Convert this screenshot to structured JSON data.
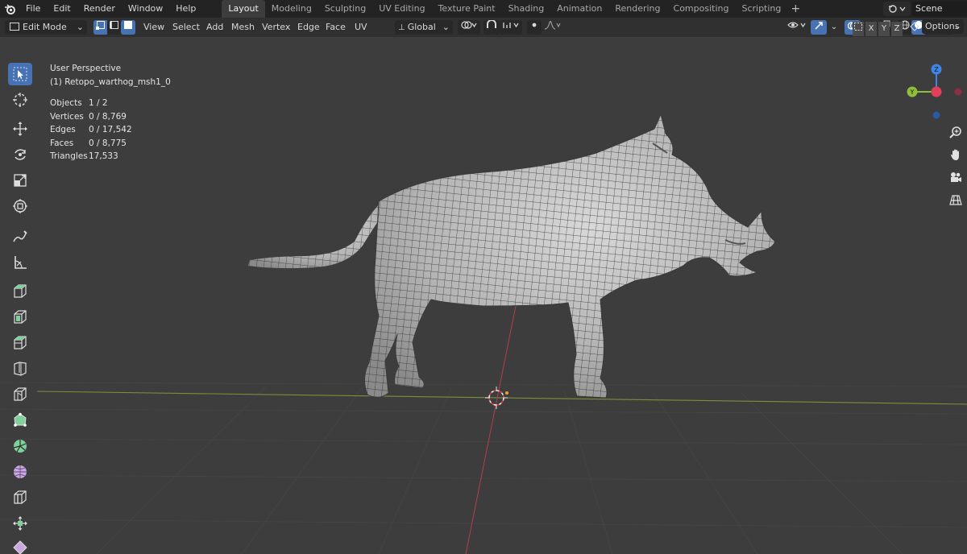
{
  "app": {
    "menus": [
      "File",
      "Edit",
      "Render",
      "Window",
      "Help"
    ]
  },
  "workspaces": {
    "tabs": [
      "Layout",
      "Modeling",
      "Sculpting",
      "UV Editing",
      "Texture Paint",
      "Shading",
      "Animation",
      "Rendering",
      "Compositing",
      "Scripting"
    ],
    "active": "Layout",
    "add_symbol": "+"
  },
  "scene": {
    "label": "Scene"
  },
  "header": {
    "mode_label": "Edit Mode",
    "menus": [
      "View",
      "Select",
      "Add",
      "Mesh",
      "Vertex",
      "Edge",
      "Face",
      "UV"
    ],
    "transform_orientation": "Global",
    "axis_x": "X",
    "axis_y": "Y",
    "axis_z": "Z",
    "options_label": "Options"
  },
  "viewport": {
    "view_name": "User Perspective",
    "object_name": "(1) Retopo_warthog_msh1_0",
    "stats": [
      {
        "label": "Objects",
        "value": "1 / 2"
      },
      {
        "label": "Vertices",
        "value": "0 / 8,769"
      },
      {
        "label": "Edges",
        "value": "0 / 17,542"
      },
      {
        "label": "Faces",
        "value": "0 / 8,775"
      },
      {
        "label": "Triangles",
        "value": "17,533"
      }
    ],
    "gizmo": {
      "x": "X",
      "y": "Y",
      "z": "Z"
    }
  },
  "colors": {
    "accent": "#4772b3",
    "x_axis": "#e0405a",
    "y_axis": "#8fbf3a",
    "z_axis": "#3d86e8",
    "viewport_bg": "#3d3d3d"
  },
  "toolbar": {
    "tools": [
      "select-box-icon",
      "cursor-icon",
      "move-icon",
      "rotate-icon",
      "scale-icon",
      "transform-icon",
      "annotate-icon",
      "measure-icon",
      "add-cube-icon",
      "extrude-icon",
      "inset-icon",
      "bevel-icon",
      "loop-cut-icon",
      "knife-icon",
      "poly-build-icon",
      "spin-icon",
      "smooth-icon",
      "edge-slide-icon",
      "shrink-fatten-icon",
      "shear-icon"
    ]
  }
}
